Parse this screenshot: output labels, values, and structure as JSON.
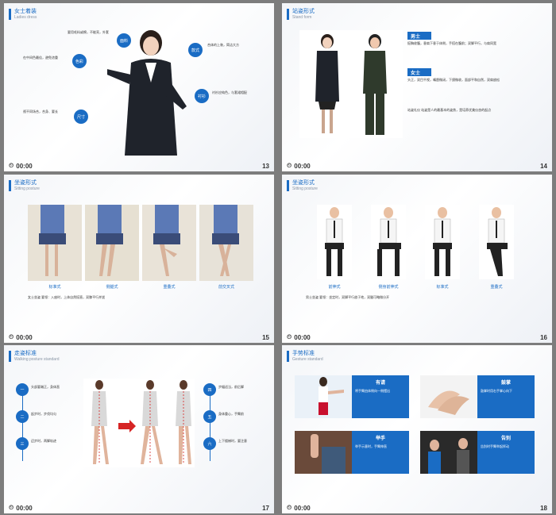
{
  "footer_time": "00:00",
  "footer_icon": "clock-icon",
  "slides": [
    {
      "num": "13",
      "title": "女士着装",
      "subtitle": "Ladies dress",
      "labels": [
        "面料",
        "色彩",
        "尺寸",
        "款式",
        "衬衫"
      ],
      "texts": [
        "要用毛料或棉，不能亮，外套",
        "在中间色最佳，避免浓重",
        "视不同场合，合身、要长",
        "合体的上装，简洁大方",
        "衬衫应纯色，与套裙相配"
      ]
    },
    {
      "num": "14",
      "title": "站姿形式",
      "subtitle": "Stand form",
      "men_label": "男士",
      "women_label": "女士",
      "men_text": "挺胸收腹，垂肩下垂于体侧，手搭在腹前；双脚平行，与肩同宽",
      "women_text": "头正，双目平视，嘴唇微闭，下颌微收，面部平和自然，双肩放松",
      "extra_text": "站姿礼仪 站姿是人的最基本的姿势，是培养优美仪态的起点"
    },
    {
      "num": "15",
      "title": "坐姿形式",
      "subtitle": "Sitting posture",
      "captions": [
        "标准式",
        "侧腿式",
        "重叠式",
        "前交叉式"
      ],
      "text": "女士坐姿  要领：入座时，上体自然挺直，双膝平行并拢"
    },
    {
      "num": "16",
      "title": "坐姿形式",
      "subtitle": "Sitting posture",
      "captions": [
        "前伸式",
        "侧身前伸式",
        "标准式",
        "重叠式"
      ],
      "text": "男士坐姿  要领：坐定时，双脚平行放于地，双腿可略微分开"
    },
    {
      "num": "17",
      "title": "走姿标准",
      "subtitle": "Walking posture standard",
      "steps_left": [
        "一",
        "二",
        "三"
      ],
      "steps_right": [
        "四",
        "五",
        "六"
      ],
      "left_texts": [
        "头部要端正，身体直",
        "起步时，步伐均匀",
        "迈步时，两脚轨迹"
      ],
      "right_texts": [
        "步幅适当，前后脚",
        "身体重心，手臂前",
        "上下楼梯时，要注意"
      ]
    },
    {
      "num": "18",
      "title": "手势标准",
      "subtitle": "Gesture standard",
      "items": [
        "有请",
        "鼓掌",
        "举手",
        "告别"
      ],
      "item_texts": [
        "将手臂由体侧向一侧摆出",
        "鼓掌时用右手掌心向下",
        "举手示意时，手臂伸直",
        "告别时手臂举起挥动"
      ]
    }
  ]
}
